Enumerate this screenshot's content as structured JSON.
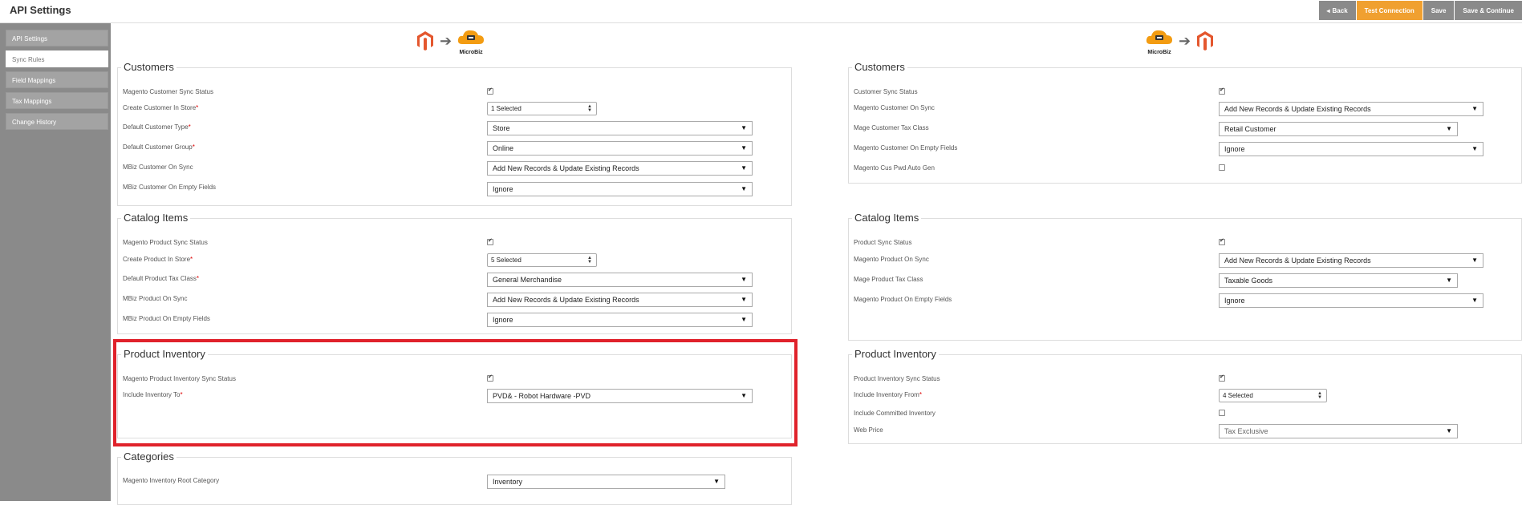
{
  "header": {
    "title": "API Settings",
    "buttons": {
      "back": "Back",
      "test": "Test Connection",
      "save": "Save",
      "save_continue": "Save & Continue"
    }
  },
  "sidebar": {
    "items": [
      {
        "label": "API Settings"
      },
      {
        "label": "Sync Rules"
      },
      {
        "label": "Field Mappings"
      },
      {
        "label": "Tax Mappings"
      },
      {
        "label": "Change History"
      }
    ]
  },
  "logos": {
    "left_caption": "MicroBiz",
    "right_caption": "MicroBiz"
  },
  "left": {
    "customers": {
      "title": "Customers",
      "rows": [
        {
          "label": "Magento Customer Sync Status",
          "checked": true
        },
        {
          "label": "Create Customer In Store",
          "value": "1 Selected"
        },
        {
          "label": "Default Customer Type",
          "value": "Store"
        },
        {
          "label": "Default Customer Group",
          "value": "Online"
        },
        {
          "label": "MBiz Customer On Sync",
          "value": "Add New Records & Update Existing Records"
        },
        {
          "label": "MBiz Customer On Empty Fields",
          "value": "Ignore"
        }
      ]
    },
    "catalog": {
      "title": "Catalog Items",
      "rows": [
        {
          "label": "Magento Product Sync Status",
          "checked": true
        },
        {
          "label": "Create Product In Store",
          "value": "5 Selected"
        },
        {
          "label": "Default Product Tax Class",
          "value": "General Merchandise"
        },
        {
          "label": "MBiz Product On Sync",
          "value": "Add New Records & Update Existing Records"
        },
        {
          "label": "MBiz Product On Empty Fields",
          "value": "Ignore"
        }
      ]
    },
    "inventory": {
      "title": "Product Inventory",
      "rows": [
        {
          "label": "Magento Product Inventory Sync Status",
          "checked": true
        },
        {
          "label": "Include Inventory To",
          "value": "PVD& - Robot Hardware -PVD"
        }
      ]
    },
    "categories": {
      "title": "Categories",
      "rows": [
        {
          "label": "Magento Inventory Root Category",
          "value": "Inventory"
        }
      ]
    }
  },
  "right": {
    "customers": {
      "title": "Customers",
      "rows": [
        {
          "label": "Customer Sync Status",
          "checked": true
        },
        {
          "label": "Magento Customer On Sync",
          "value": "Add New Records & Update Existing Records"
        },
        {
          "label": "Mage Customer Tax Class",
          "value": "Retail Customer"
        },
        {
          "label": "Magento Customer On Empty Fields",
          "value": "Ignore"
        },
        {
          "label": "Magento Cus Pwd Auto Gen",
          "checked": false
        }
      ]
    },
    "catalog": {
      "title": "Catalog Items",
      "rows": [
        {
          "label": "Product Sync Status",
          "checked": true
        },
        {
          "label": "Magento Product On Sync",
          "value": "Add New Records & Update Existing Records"
        },
        {
          "label": "Mage Product Tax Class",
          "value": "Taxable Goods"
        },
        {
          "label": "Magento Product On Empty Fields",
          "value": "Ignore"
        }
      ]
    },
    "inventory": {
      "title": "Product Inventory",
      "rows": [
        {
          "label": "Product Inventory Sync Status",
          "checked": true
        },
        {
          "label": "Include Inventory From",
          "value": "4 Selected"
        },
        {
          "label": "Include Committed Inventory",
          "checked": false
        },
        {
          "label": "Web Price",
          "value": "Tax Exclusive"
        }
      ]
    }
  },
  "colors": {
    "accent": "#f0a030",
    "sidebar": "#8a8a8a",
    "highlight": "#e0222b",
    "magento": "#e4572e"
  }
}
